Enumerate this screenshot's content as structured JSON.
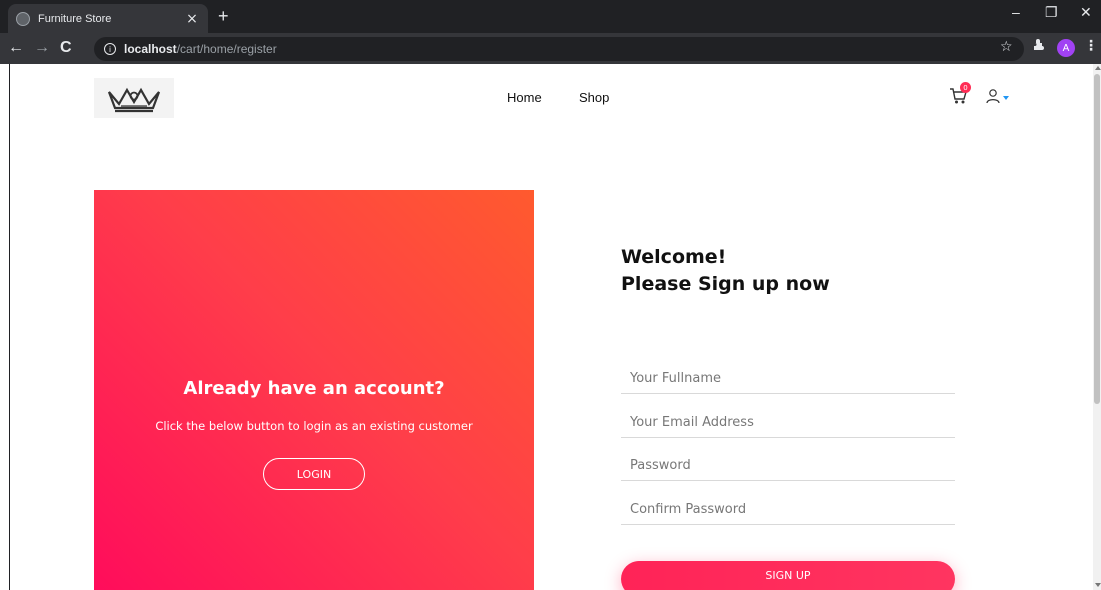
{
  "browser": {
    "tab_title": "Furniture Store",
    "tab_close": "×",
    "new_tab": "+",
    "url_host": "localhost",
    "url_path": "/cart/home/register",
    "info": "i",
    "profile_initial": "A",
    "minimize": "–",
    "restore": "❐",
    "close": "✕"
  },
  "nav": {
    "home": "Home",
    "shop": "Shop",
    "cart_count": "0"
  },
  "promo": {
    "title": "Already have an account?",
    "text": "Click the below button to login as an existing customer",
    "login_label": "LOGIN"
  },
  "form": {
    "welcome_line1": "Welcome!",
    "welcome_line2": "Please Sign up now",
    "fullname_placeholder": "Your Fullname",
    "email_placeholder": "Your Email Address",
    "password_placeholder": "Password",
    "confirm_placeholder": "Confirm Password",
    "signup_label": "SIGN UP"
  },
  "colors": {
    "accent": "#ff2357",
    "gradient_start": "#ff0a5c",
    "gradient_end": "#ff5a2e",
    "user_caret": "#2196f3"
  }
}
